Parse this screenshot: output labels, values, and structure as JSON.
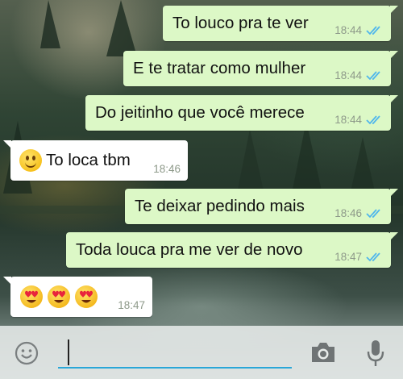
{
  "messages": [
    {
      "direction": "out",
      "text": "To louco pra te ver",
      "time": "18:44",
      "status": "read"
    },
    {
      "direction": "out",
      "text": "E te tratar como mulher",
      "time": "18:44",
      "status": "read"
    },
    {
      "direction": "out",
      "text": "Do jeitinho que você merece",
      "time": "18:44",
      "status": "read"
    },
    {
      "direction": "in",
      "text": "To loca tbm",
      "time": "18:46",
      "emoji": [
        "smiling-face-icon"
      ]
    },
    {
      "direction": "out",
      "text": "Te deixar pedindo mais",
      "time": "18:46",
      "status": "read"
    },
    {
      "direction": "out",
      "text": "Toda louca pra me ver de novo",
      "time": "18:47",
      "status": "read"
    },
    {
      "direction": "in",
      "text": "",
      "time": "18:47",
      "emoji": [
        "heart-eyes-icon",
        "heart-eyes-icon",
        "heart-eyes-icon"
      ]
    }
  ],
  "composer": {
    "value": "",
    "icons": [
      "emoji-icon",
      "camera-icon",
      "microphone-icon"
    ]
  },
  "colors": {
    "outgoing_bubble": "#dcf8c6",
    "incoming_bubble": "#ffffff",
    "read_ticks": "#4fb6ec",
    "input_underline": "#2aa7d8"
  }
}
